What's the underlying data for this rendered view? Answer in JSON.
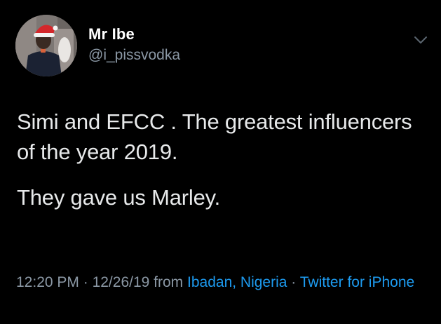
{
  "tweet": {
    "author": {
      "display_name": "Mr Ibe",
      "handle": "@i_pissvodka",
      "avatar_icon": "avatar-photo"
    },
    "menu_icon": "chevron-down-icon",
    "text_lines": [
      "Simi and EFCC . The greatest influencers of the year 2019.",
      "They gave us Marley."
    ],
    "meta": {
      "time": "12:20 PM",
      "separator": "·",
      "date": "12/26/19",
      "from_label": "from",
      "location": "Ibadan, Nigeria",
      "source": "Twitter for iPhone"
    }
  },
  "colors": {
    "background": "#000000",
    "text": "#e7e9ea",
    "muted": "#8b98a5",
    "link": "#1d9bf0"
  }
}
